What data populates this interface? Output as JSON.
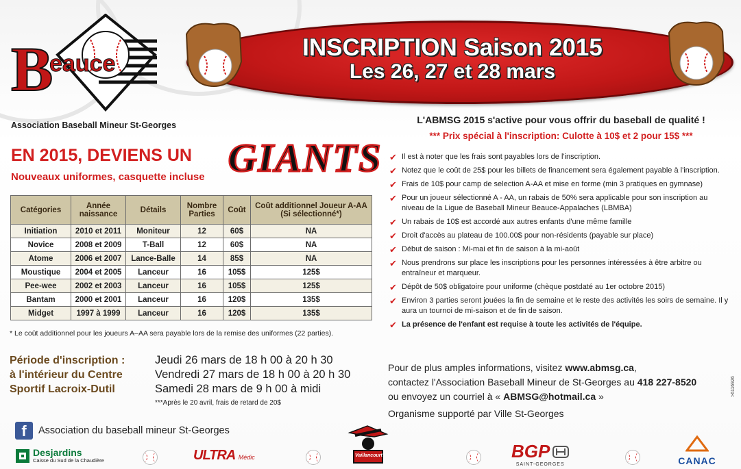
{
  "logo": {
    "wordmark": "Beauce",
    "org_name": "Association Baseball Mineur St-Georges"
  },
  "banner": {
    "title": "INSCRIPTION Saison 2015",
    "dates": "Les 26, 27 et 28 mars"
  },
  "left": {
    "headline": "EN 2015, DEVIENS UN",
    "team": "GIANTS",
    "subheadline": "Nouveaux uniformes, casquette incluse",
    "table": {
      "headers": [
        "Catégories",
        "Année naissance",
        "Détails",
        "Nombre Parties",
        "Coût",
        "Coût additionnel Joueur A-AA (Si sélectionné*)"
      ],
      "rows": [
        [
          "Initiation",
          "2010 et 2011",
          "Moniteur",
          "12",
          "60$",
          "NA"
        ],
        [
          "Novice",
          "2008 et 2009",
          "T-Ball",
          "12",
          "60$",
          "NA"
        ],
        [
          "Atome",
          "2006 et 2007",
          "Lance-Balle",
          "14",
          "85$",
          "NA"
        ],
        [
          "Moustique",
          "2004 et 2005",
          "Lanceur",
          "16",
          "105$",
          "125$"
        ],
        [
          "Pee-wee",
          "2002 et 2003",
          "Lanceur",
          "16",
          "105$",
          "125$"
        ],
        [
          "Bantam",
          "2000 et 2001",
          "Lanceur",
          "16",
          "120$",
          "135$"
        ],
        [
          "Midget",
          "1997 à 1999",
          "Lanceur",
          "16",
          "120$",
          "135$"
        ]
      ]
    },
    "footnote": "* Le coût additionnel pour les joueurs A–AA sera payable lors de la remise des uniformes (22 parties).",
    "period_label": [
      "Période d'inscription :",
      "à l'intérieur du Centre",
      "Sportif Lacroix-Dutil"
    ],
    "schedule": [
      "Jeudi 26 mars de 18 h 00 à 20 h 30",
      "Vendredi 27 mars de 18 h 00 à 20 h 30",
      "Samedi 28 mars de 9 h 00 à midi"
    ],
    "late_note": "***Après le 20 avril, frais de retard de 20$",
    "facebook": "Association du baseball mineur St-Georges"
  },
  "right": {
    "intro": "L'ABMSG 2015 s'active pour vous offrir du baseball de qualité !",
    "promo": "*** Prix spécial à l'inscription: Culotte à 10$ et 2 pour 15$ ***",
    "bullets": [
      "Il est à noter que les frais sont payables lors de l'inscription.",
      "Notez que le coût de 25$ pour les billets de financement sera également payable à l'inscription.",
      "Frais de 10$ pour camp de selection A-AA et mise en forme (min 3 pratiques en gymnase)",
      "Pour un joueur sélectionné A - AA, un rabais de 50% sera applicable pour son inscription au niveau de la Ligue de Baseball Mineur Beauce-Appalaches (LBMBA)",
      "Un rabais de 10$ est accordé aux autres enfants d'une même famille",
      "Droit d'accès au plateau de 100.00$ pour non-résidents (payable sur place)",
      "Début de saison : Mi-mai et fin de saison à la mi-août",
      "Nous prendrons sur place les inscriptions pour les personnes intéressées à être arbitre ou entraîneur et marqueur.",
      "Dépôt de 50$ obligatoire pour uniforme (chèque postdaté au 1er octobre 2015)",
      "Environ 3 parties seront jouées la fin de semaine et le reste des activités les soirs de semaine. Il y aura un tournoi de mi-saison et de fin de saison.",
      "La présence de l'enfant est requise à toute les activités de l'équipe."
    ],
    "contact": {
      "line1_pre": "Pour de plus amples informations, visitez ",
      "website": "www.abmsg.ca",
      "line1_post": ",",
      "line2_pre": "contactez l'Association Baseball Mineur de St-Georges au ",
      "phone": "418 227-8520",
      "line3_pre": "ou envoyez un courriel à « ",
      "email": "ABMSG@hotmail.ca",
      "line3_post": " »"
    },
    "support": "Organisme supporté par Ville St-Georges",
    "side_code": ">6116926"
  },
  "sponsors": {
    "desjardins": "Desjardins",
    "desjardins_sub": "Caisse du Sud de la Chaudière",
    "ultra": "ULTRA",
    "ultra_sub": "Médic",
    "vaillancourt": "Vaillancourt",
    "bgp": "BGP",
    "bgp_sub": "SAINT-GEORGES",
    "canac": "CANAC"
  },
  "colors": {
    "red": "#d21f1f",
    "banner_red": "#c11717",
    "table_header": "#cfc6a6",
    "brown": "#6b4a1f"
  }
}
